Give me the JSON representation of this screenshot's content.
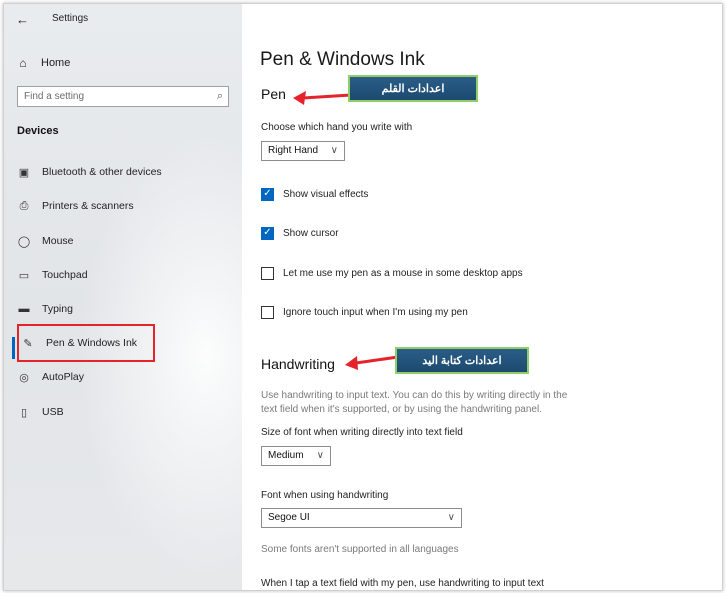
{
  "window": {
    "title": "Settings",
    "back_glyph": "←"
  },
  "sidebar": {
    "home": {
      "label": "Home",
      "icon": "home-icon",
      "glyph": "⌂"
    },
    "search": {
      "placeholder": "Find a setting",
      "icon": "search-icon",
      "glyph": "⌕"
    },
    "section_title": "Devices",
    "items": [
      {
        "label": "Bluetooth & other devices",
        "icon": "bluetooth-devices-icon",
        "glyph": "▣"
      },
      {
        "label": "Printers & scanners",
        "icon": "printer-icon",
        "glyph": "⎙"
      },
      {
        "label": "Mouse",
        "icon": "mouse-icon",
        "glyph": "◯"
      },
      {
        "label": "Touchpad",
        "icon": "touchpad-icon",
        "glyph": "▭"
      },
      {
        "label": "Typing",
        "icon": "keyboard-icon",
        "glyph": "▬"
      },
      {
        "label": "Pen & Windows Ink",
        "icon": "pen-icon",
        "glyph": "✎",
        "selected": true
      },
      {
        "label": "AutoPlay",
        "icon": "autoplay-icon",
        "glyph": "◎"
      },
      {
        "label": "USB",
        "icon": "usb-icon",
        "glyph": "▯"
      }
    ]
  },
  "main": {
    "title": "Pen & Windows Ink",
    "pen": {
      "heading": "Pen",
      "hand_label": "Choose which hand you write with",
      "hand_value": "Right Hand",
      "options": [
        {
          "label": "Show visual effects",
          "checked": true
        },
        {
          "label": "Show cursor",
          "checked": true
        },
        {
          "label": "Let me use my pen as a mouse in some desktop apps",
          "checked": false
        },
        {
          "label": "Ignore touch input when I'm using my pen",
          "checked": false
        }
      ]
    },
    "handwriting": {
      "heading": "Handwriting",
      "desc_line1": "Use handwriting to input text. You can do this by writing directly in the",
      "desc_line2": "text field when it's supported, or by using the handwriting panel.",
      "size_label": "Size of font when writing directly into text field",
      "size_value": "Medium",
      "font_label": "Font when using handwriting",
      "font_value": "Segoe UI",
      "font_note": "Some fonts aren't supported in all languages",
      "tap_label": "When I tap a text field with my pen, use handwriting to input text"
    },
    "chevron_glyph": "∨",
    "check_glyph": "✓"
  },
  "annotations": {
    "pen_callout": "اعدادات القلم",
    "handwriting_callout": "اعدادات كتابة اليد",
    "callout_border_color": "#8fcf66",
    "callout_bg_color": "#1f4f76",
    "arrow_color": "#e5232a",
    "highlight_color": "#e5232a"
  }
}
